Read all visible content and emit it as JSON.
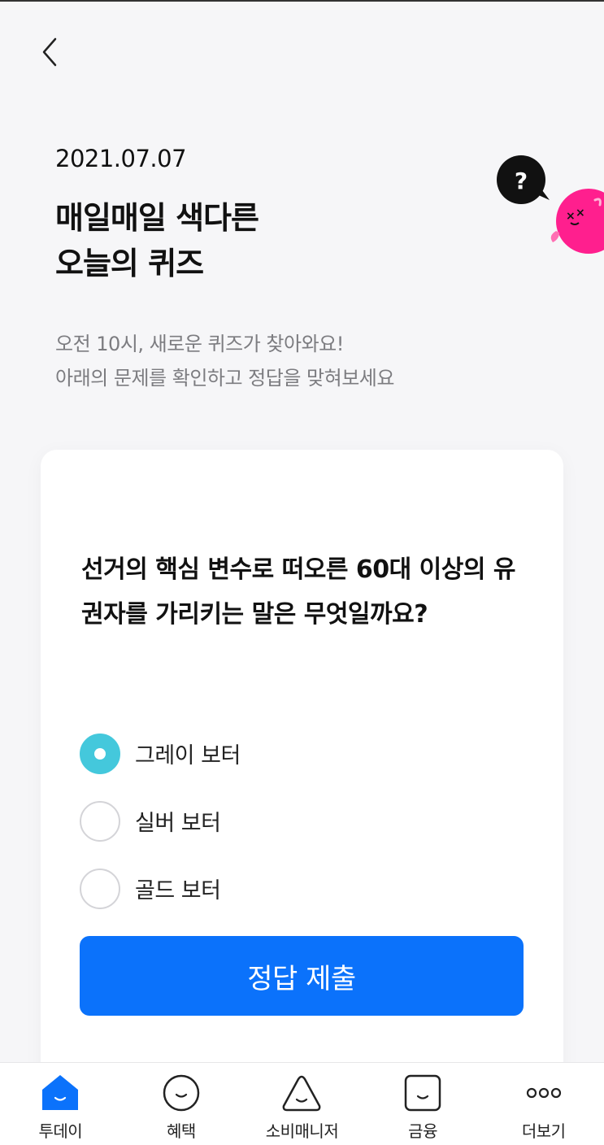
{
  "header": {
    "back_icon": "chevron-left-icon",
    "date": "2021.07.07",
    "title_lines": [
      "매일매일 색다른",
      "오늘의 퀴즈"
    ],
    "subtitle_lines": [
      "오전 10시, 새로운 퀴즈가 찾아와요!",
      "아래의 문제를 확인하고 정답을 맞혀보세요"
    ],
    "mascot": {
      "bubble_text": "?",
      "bubble_color": "#111111",
      "character_color": "#ff1f8e"
    }
  },
  "quiz": {
    "question": "선거의 핵심 변수로 떠오른 60대 이상의 유권자를 가리키는 말은 무엇일까요?",
    "options": [
      {
        "label": "그레이 보터",
        "selected": true
      },
      {
        "label": "실버 보터",
        "selected": false
      },
      {
        "label": "골드 보터",
        "selected": false
      }
    ],
    "submit_label": "정답 제출",
    "colors": {
      "accent": "#0b72fb",
      "radio_selected": "#44c8dc"
    }
  },
  "tabbar": {
    "tabs": [
      {
        "label": "투데이",
        "icon": "home-icon",
        "active": true
      },
      {
        "label": "혜택",
        "icon": "smile-circle-icon",
        "active": false
      },
      {
        "label": "소비매니저",
        "icon": "smile-triangle-icon",
        "active": false
      },
      {
        "label": "금융",
        "icon": "smile-square-icon",
        "active": false
      },
      {
        "label": "더보기",
        "icon": "more-dots-icon",
        "active": false
      }
    ],
    "active_color": "#0b72fb"
  }
}
